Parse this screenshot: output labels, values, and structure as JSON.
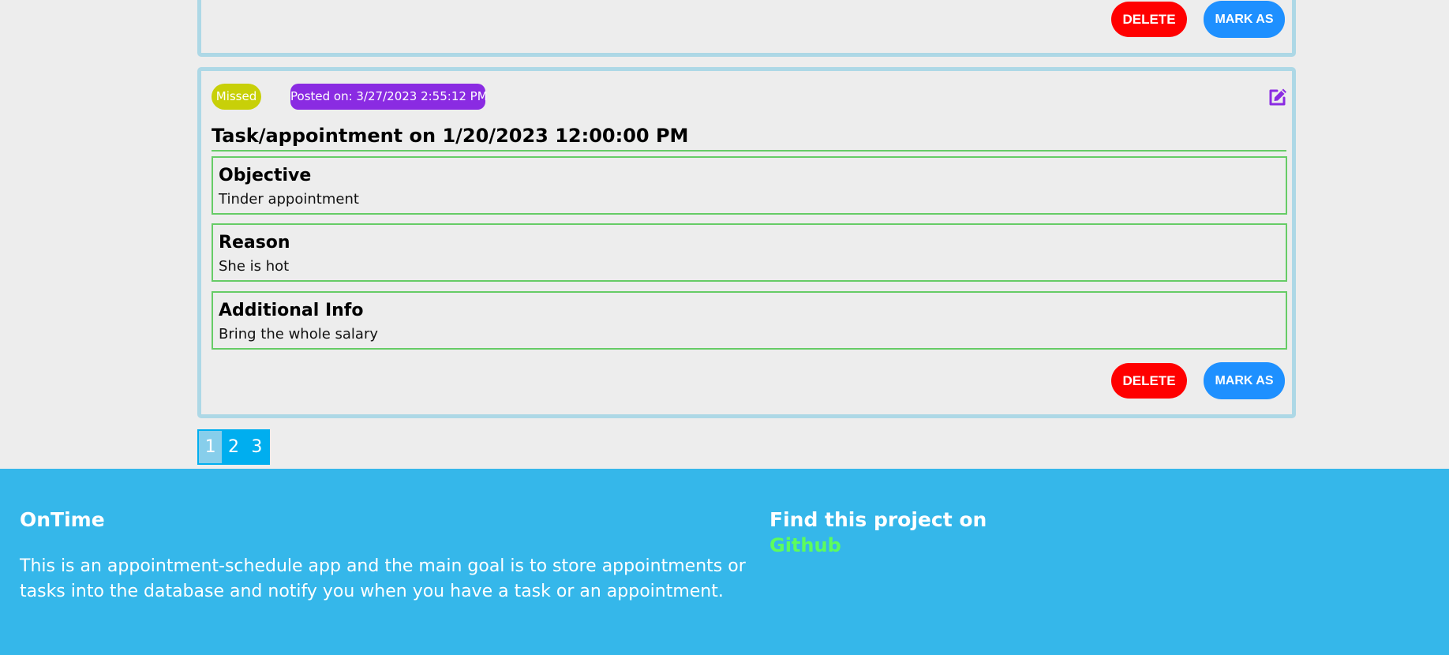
{
  "previous_task": {
    "delete_label": "DELETE",
    "mark_label": "MARK AS"
  },
  "task": {
    "status": "Missed",
    "posted": "Posted on: 3/27/2023 2:55:12 PM",
    "title": "Task/appointment on 1/20/2023 12:00:00 PM",
    "sections": [
      {
        "heading": "Objective",
        "text": "Tinder appointment"
      },
      {
        "heading": "Reason",
        "text": "She is hot"
      },
      {
        "heading": "Additional Info",
        "text": "Bring the whole salary"
      }
    ],
    "delete_label": "DELETE",
    "mark_label": "MARK AS",
    "icons": {
      "edit": "edit-icon"
    }
  },
  "pagination": {
    "pages": [
      "1",
      "2",
      "3"
    ],
    "active": "1"
  },
  "footer": {
    "brand": "OnTime",
    "description": "This is an appointment-schedule app and the main goal is to store appointments or tasks into the database and notify you when you have a task or an appointment.",
    "find_label": "Find this project on",
    "link_label": "Github"
  },
  "colors": {
    "delete": "#ff0000",
    "mark": "#1e90ff",
    "missed": "#c8d008",
    "posted": "#8a2be2",
    "card_border": "#add8e6",
    "section_border": "#66cc66",
    "footer": "#35b7ea",
    "pagination": "#00aeef",
    "github_link": "#5dfc5d"
  }
}
